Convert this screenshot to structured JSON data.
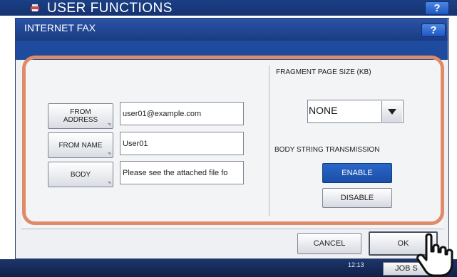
{
  "background_app": {
    "title": "USER FUNCTIONS",
    "help_label": "?",
    "clock": [
      "",
      "12:13"
    ],
    "job_status_label": "JOB S"
  },
  "dialog": {
    "title": "INTERNET FAX",
    "help_label": "?",
    "fields": [
      {
        "button_label": "FROM ADDRESS",
        "value": "user01@example.com"
      },
      {
        "button_label": "FROM NAME",
        "value": "User01"
      },
      {
        "button_label": "BODY",
        "value": "Please see the attached file fo"
      }
    ],
    "fragment_size": {
      "label": "FRAGMENT PAGE SIZE (KB)",
      "selected": "NONE"
    },
    "body_string": {
      "label": "BODY STRING TRANSMISSION",
      "enable_label": "ENABLE",
      "disable_label": "DISABLE",
      "selected": "ENABLE"
    },
    "cancel_label": "CANCEL",
    "ok_label": "OK"
  },
  "colors": {
    "title_bar": "#1a3b82",
    "highlight": "#e08a68",
    "toggle_selected": "#1b4ea6"
  },
  "icons": {
    "app_logo": "printer-logo-icon",
    "cursor": "hand-pointer-icon"
  }
}
